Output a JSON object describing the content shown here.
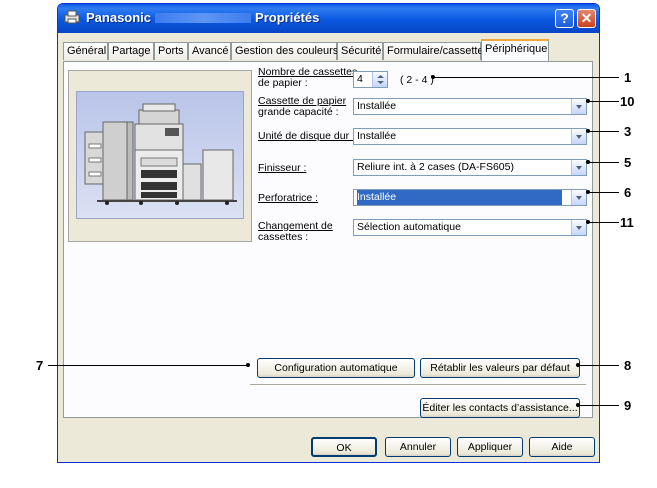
{
  "window": {
    "title_brand": "Panasonic",
    "title_suffix": "Propriétés",
    "help_label": "?",
    "close_label": "✕"
  },
  "tabs": [
    {
      "label": "Général"
    },
    {
      "label": "Partage"
    },
    {
      "label": "Ports"
    },
    {
      "label": "Avancé"
    },
    {
      "label": "Gestion des couleurs"
    },
    {
      "label": "Sécurité"
    },
    {
      "label": "Formulaire/cassette"
    },
    {
      "label": "Périphérique",
      "active": true
    }
  ],
  "settings": {
    "cassettes": {
      "label_line1": "Nombre de cassettes",
      "label_line2": "de papier :",
      "value": "4",
      "range": "( 2 - 4 )"
    },
    "grande_capacite": {
      "label_line1": "Cassette de papier",
      "label_line2": "grande capacité :",
      "value": "Installée"
    },
    "disque_dur": {
      "label": "Unité de disque dur :",
      "value": "Installée"
    },
    "finisseur": {
      "label": "Finisseur :",
      "value": "Reliure int. à 2 cases (DA-FS605)"
    },
    "perforatrice": {
      "label": "Perforatrice :",
      "value": "Installée"
    },
    "changement": {
      "label_line1": "Changement de",
      "label_line2": "cassettes :",
      "value": "Sélection automatique"
    }
  },
  "buttons": {
    "config_auto": "Configuration automatique",
    "retablir": "Rétablir les valeurs par défaut",
    "editer": "Éditer les contacts d’assistance...",
    "ok": "OK",
    "annuler": "Annuler",
    "appliquer": "Appliquer",
    "aide": "Aide"
  },
  "callouts": {
    "c1": "1",
    "c10": "10",
    "c3": "3",
    "c5": "5",
    "c6": "6",
    "c11": "11",
    "c7": "7",
    "c8": "8",
    "c9": "9"
  },
  "colors": {
    "titlebar": "#0a58e0",
    "selection": "#316ac5",
    "active_tab_accent": "#f3a73b"
  }
}
